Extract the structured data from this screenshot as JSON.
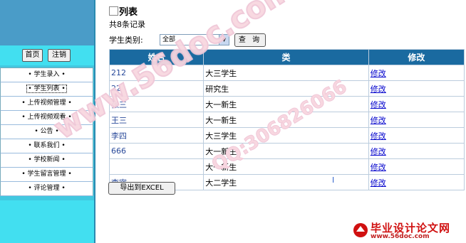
{
  "sidebar": {
    "home_label": "首页",
    "logout_label": "注销",
    "menu": [
      {
        "label": "• 学生录入 •",
        "active": false
      },
      {
        "label": "• 学生列表 •",
        "active": true
      },
      {
        "label": "• 上传视频管理 •",
        "active": false
      },
      {
        "label": "• 上传视频观看 •",
        "active": false
      },
      {
        "label": "• 公告 •",
        "active": false
      },
      {
        "label": "• 联系我们 •",
        "active": false
      },
      {
        "label": "• 学校新闻 •",
        "active": false
      },
      {
        "label": "• 学生留言管理 •",
        "active": false
      },
      {
        "label": "• 评论管理 •",
        "active": false
      }
    ]
  },
  "main": {
    "title": "列表",
    "record_count": "共8条记录",
    "filter_label": "学生类别:",
    "filter_value": "全部",
    "query_label": "查 询",
    "export_label": "导出到EXCEL",
    "columns": [
      "姓名",
      "类",
      "修改"
    ],
    "rows": [
      {
        "name": "212",
        "type": "大三学生",
        "edit": "修改"
      },
      {
        "name": "22",
        "type": "研究生",
        "edit": "修改"
      },
      {
        "name": "张三",
        "type": "大一新生",
        "edit": "修改"
      },
      {
        "name": "王三",
        "type": "大一新生",
        "edit": "修改"
      },
      {
        "name": "李四",
        "type": "大三学生",
        "edit": "修改"
      },
      {
        "name": "666",
        "type": "大一新生",
        "edit": "修改"
      },
      {
        "name": "",
        "type": "大一新生",
        "edit": "修改"
      },
      {
        "name": "李密",
        "type": "大二学生",
        "edit": "修改"
      }
    ]
  },
  "watermark": {
    "url_text": "www.56doc.com",
    "qq_text": "QQ:306826066",
    "logo_title": "毕业设计论文网",
    "logo_url": "www.56doc.com"
  },
  "colors": {
    "sidebar_bg": "#42c8e0",
    "header_bg": "#1a6aa0",
    "link": "#0000cc"
  }
}
